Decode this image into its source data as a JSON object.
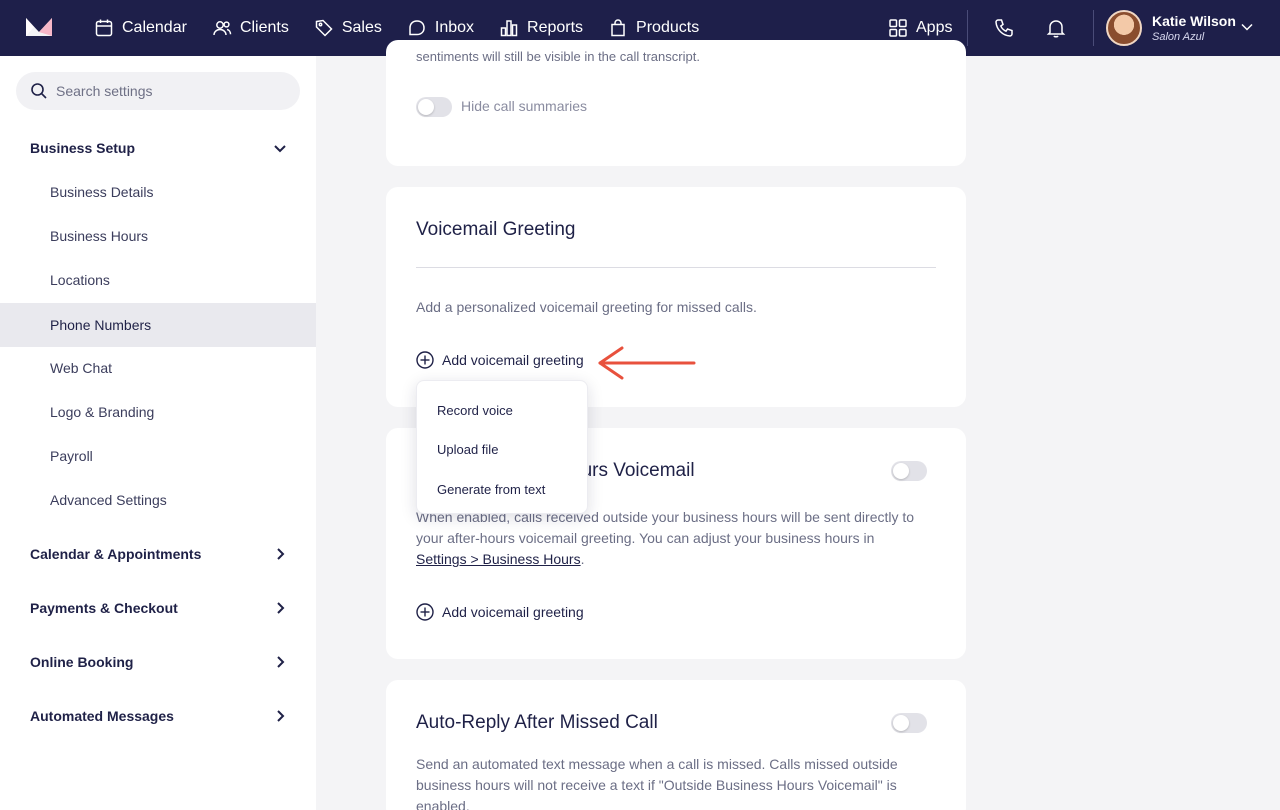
{
  "nav": {
    "items": [
      {
        "label": "Calendar",
        "icon": "calendar-icon"
      },
      {
        "label": "Clients",
        "icon": "users-icon"
      },
      {
        "label": "Sales",
        "icon": "tag-icon"
      },
      {
        "label": "Inbox",
        "icon": "inbox-icon"
      },
      {
        "label": "Reports",
        "icon": "bar-chart-icon"
      },
      {
        "label": "Products",
        "icon": "shopping-bag-icon"
      }
    ],
    "apps_label": "Apps"
  },
  "user": {
    "name": "Katie Wilson",
    "business": "Salon Azul"
  },
  "sidebar": {
    "search_placeholder": "Search settings",
    "business_setup": {
      "label": "Business Setup",
      "items": [
        "Business Details",
        "Business Hours",
        "Locations",
        "Phone Numbers",
        "Web Chat",
        "Logo & Branding",
        "Payroll",
        "Advanced Settings"
      ],
      "active": "Phone Numbers"
    },
    "sections": [
      "Calendar & Appointments",
      "Payments & Checkout",
      "Online Booking",
      "Automated Messages"
    ]
  },
  "main": {
    "top_card": {
      "partial_text": "sentiments will still be visible in the call transcript.",
      "hide_summaries_label": "Hide call summaries"
    },
    "voicemail_card": {
      "title": "Voicemail Greeting",
      "description": "Add a personalized voicemail greeting for missed calls.",
      "add_label": "Add voicemail greeting"
    },
    "dropdown": {
      "options": [
        "Record voice",
        "Upload file",
        "Generate from text"
      ]
    },
    "after_hours_card": {
      "title_visible": "ours Voicemail",
      "description_before": "When enabled, calls received outside your business hours will be sent directly to your after-hours voicemail greeting. You can adjust your business hours in ",
      "description_link": "Settings > Business Hours",
      "description_after": ".",
      "add_label": "Add voicemail greeting"
    },
    "auto_reply_card": {
      "title": "Auto-Reply After Missed Call",
      "description": "Send an automated text message when a call is missed. Calls missed outside business hours will not receive a text if \"Outside Business Hours Voicemail\" is enabled."
    }
  },
  "colors": {
    "nav_bg": "#1e1f4a",
    "annotation_arrow": "#e8513d",
    "active_bg": "#e9e9ee"
  }
}
